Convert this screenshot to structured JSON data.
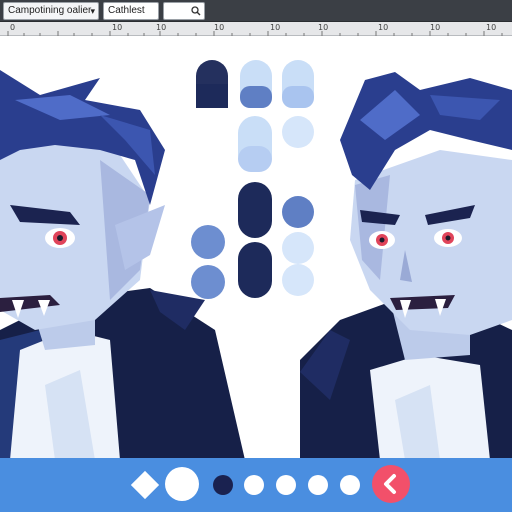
{
  "toolbar": {
    "document_label": "Campotining oalier",
    "dropdown_arrow": "▾",
    "layer_label": "Cathlest",
    "search_icon": "search-icon"
  },
  "ruler": {
    "ticks": [
      "0",
      "10",
      "10",
      "10",
      "10",
      "10",
      "10",
      "10",
      "10"
    ]
  },
  "palette": {
    "swatches": [
      {
        "color": "#24305e",
        "shape": "pill"
      },
      {
        "color": "#c9def7",
        "shape": "pill-top"
      },
      {
        "color": "#c9def7",
        "shape": "pill-top"
      },
      {
        "color": "#b6cdf2",
        "shape": "pill"
      },
      {
        "color": "#1d2a5a",
        "shape": "pill"
      },
      {
        "color": "#5f7fc4",
        "shape": "circle"
      },
      {
        "color": "#6d8ed0",
        "shape": "circle"
      }
    ]
  },
  "bottombar": {
    "buttons": [
      {
        "name": "diamond-button",
        "color": "#ffffff"
      },
      {
        "name": "large-circle-button",
        "color": "#ffffff"
      },
      {
        "name": "dark-dot-button",
        "color": "#1a2250"
      },
      {
        "name": "dot-button-1",
        "color": "#ffffff"
      },
      {
        "name": "dot-button-2",
        "color": "#ffffff"
      },
      {
        "name": "dot-button-3",
        "color": "#ffffff"
      },
      {
        "name": "dot-button-4",
        "color": "#ffffff"
      },
      {
        "name": "back-button",
        "color": "#f2506a"
      }
    ]
  },
  "colors": {
    "toolbar_bg": "#3b3f45",
    "accent_blue": "#4a8ee0",
    "accent_red": "#f2506a"
  }
}
